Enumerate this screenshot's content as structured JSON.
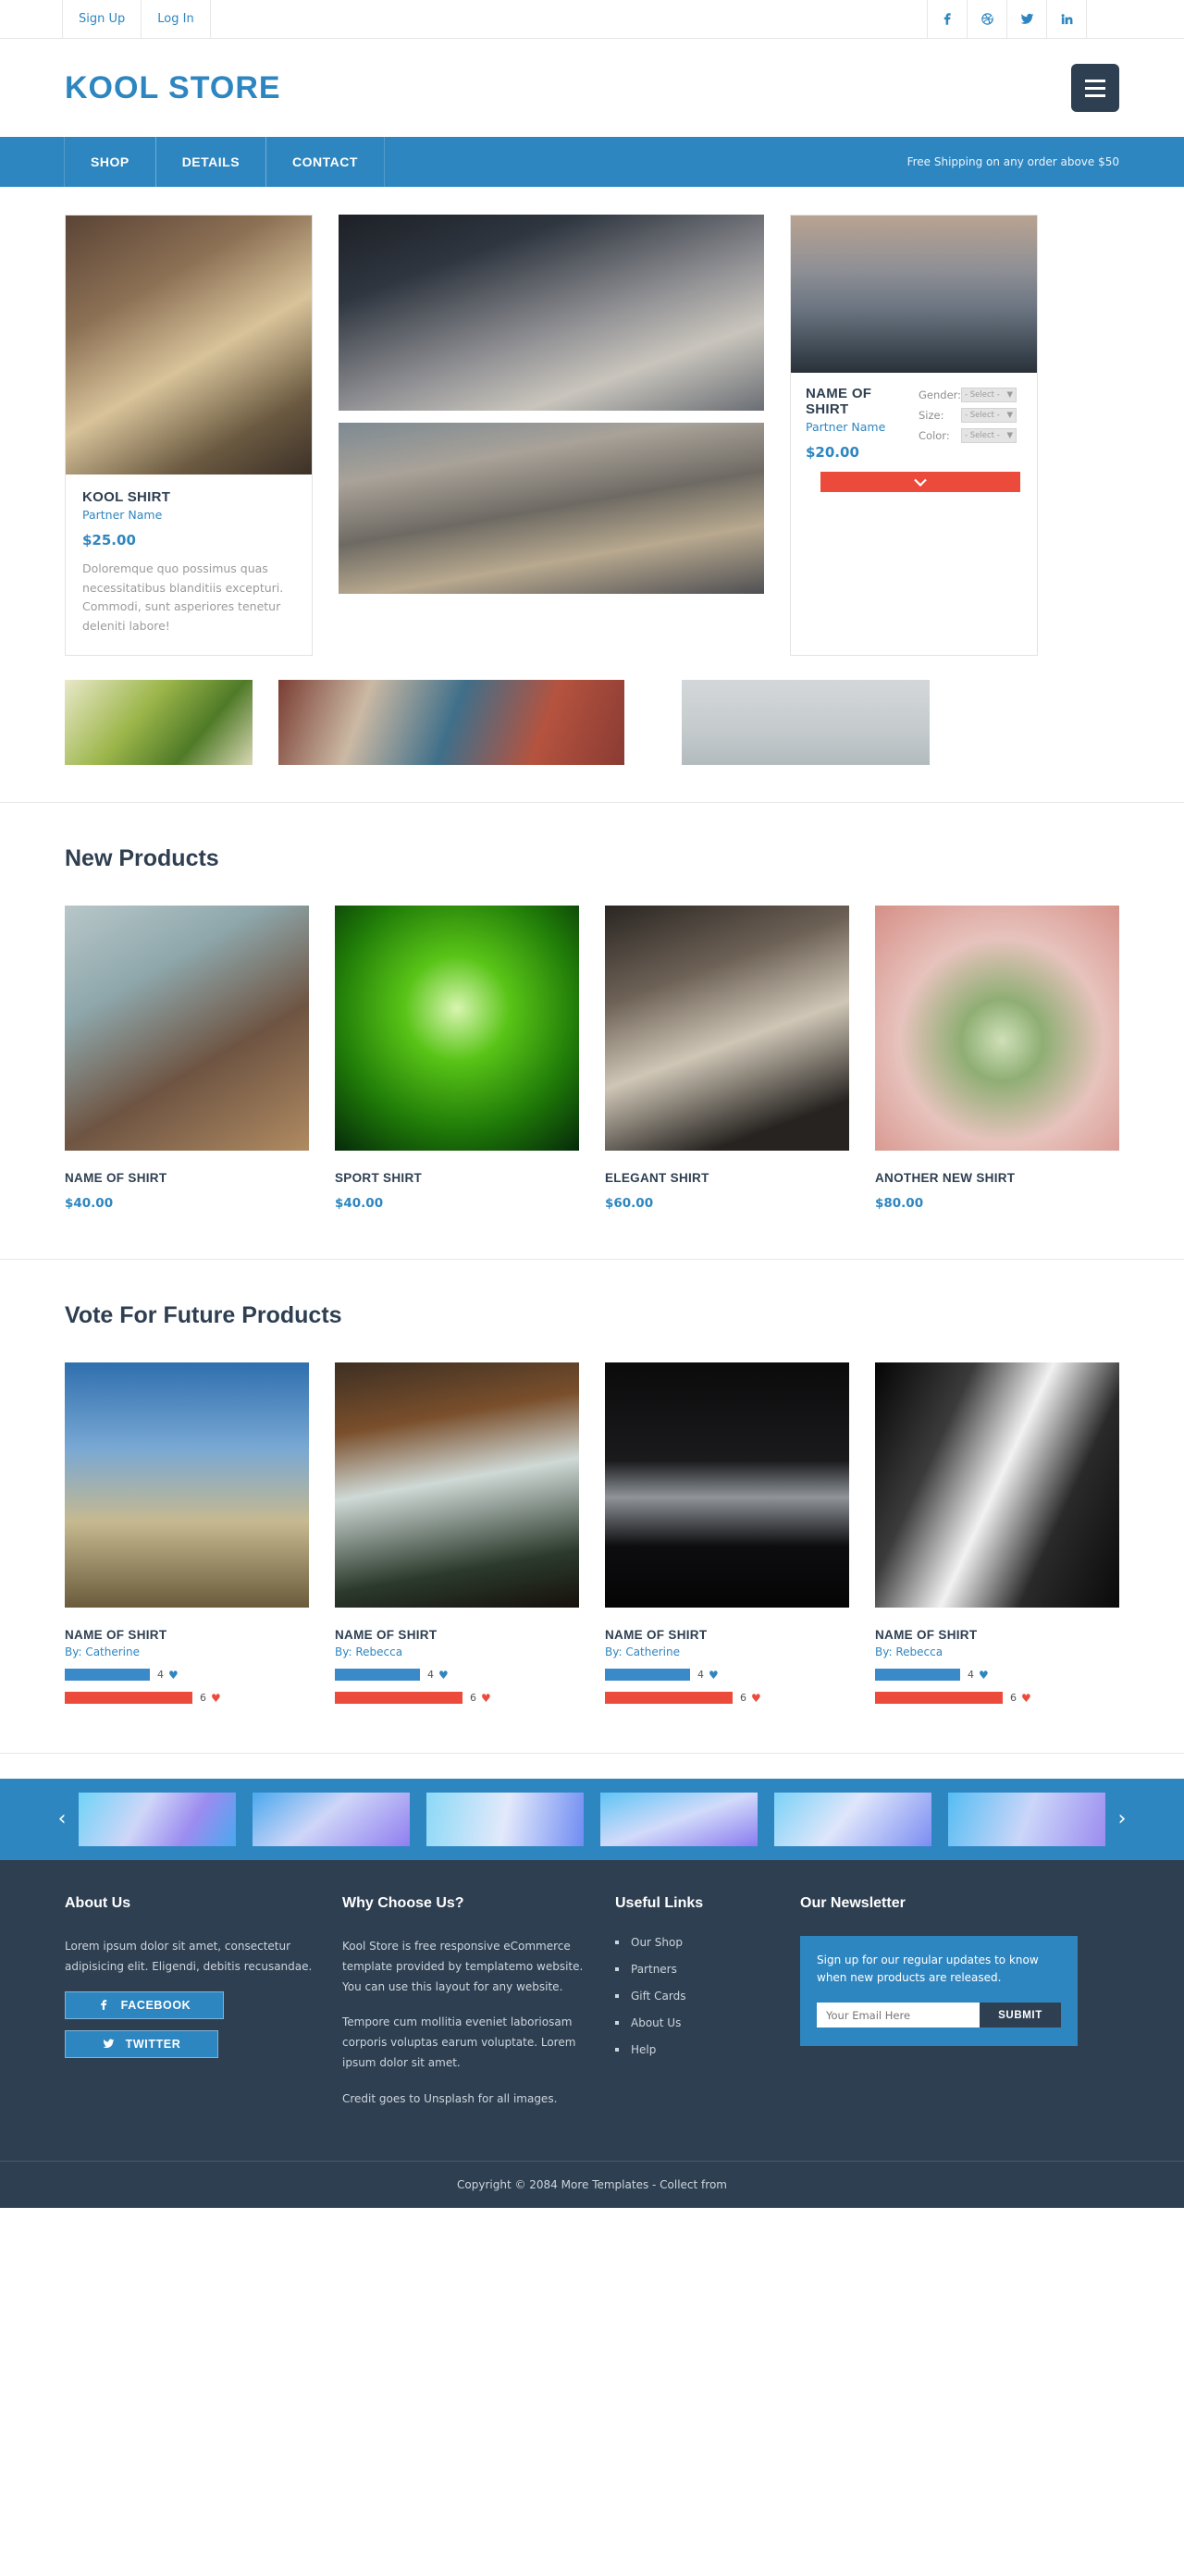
{
  "topbar": {
    "links": [
      {
        "label": "Sign Up",
        "name": "signup-link"
      },
      {
        "label": "Log In",
        "name": "login-link"
      }
    ],
    "social": [
      {
        "name": "facebook-icon",
        "label": "f"
      },
      {
        "name": "dribbble-icon",
        "label": "dribbble"
      },
      {
        "name": "twitter-icon",
        "label": "twitter"
      },
      {
        "name": "linkedin-icon",
        "label": "in"
      }
    ]
  },
  "brand": {
    "title": "KOOL STORE"
  },
  "nav": {
    "items": [
      {
        "label": "SHOP"
      },
      {
        "label": "DETAILS"
      },
      {
        "label": "CONTACT"
      }
    ],
    "note": "Free Shipping on any order above $50"
  },
  "hero": {
    "feature_card": {
      "title": "KOOL SHIRT",
      "partner": "Partner Name",
      "price": "$25.00",
      "description": "Doloremque quo possimus quas necessitatibus blanditiis excepturi. Commodi, sunt asperiores tenetur deleniti labore!"
    },
    "option_card": {
      "title": "NAME OF SHIRT",
      "partner": "Partner Name",
      "price": "$20.00",
      "options": [
        {
          "label": "Gender:",
          "value": "- Select -"
        },
        {
          "label": "Size:",
          "value": "- Select -"
        },
        {
          "label": "Color:",
          "value": "- Select -"
        }
      ],
      "cart_icon": "chevron-down-icon"
    }
  },
  "new_products": {
    "title": "New Products",
    "items": [
      {
        "name": "NAME OF SHIRT",
        "price": "$40.00"
      },
      {
        "name": "SPORT SHIRT",
        "price": "$40.00"
      },
      {
        "name": "ELEGANT SHIRT",
        "price": "$60.00"
      },
      {
        "name": "ANOTHER NEW SHIRT",
        "price": "$80.00"
      }
    ]
  },
  "vote": {
    "title": "Vote For Future Products",
    "items": [
      {
        "name": "NAME OF SHIRT",
        "by": "By: Catherine",
        "up": "4",
        "down": "6"
      },
      {
        "name": "NAME OF SHIRT",
        "by": "By: Rebecca",
        "up": "4",
        "down": "6"
      },
      {
        "name": "NAME OF SHIRT",
        "by": "By: Catherine",
        "up": "4",
        "down": "6"
      },
      {
        "name": "NAME OF SHIRT",
        "by": "By: Rebecca",
        "up": "4",
        "down": "6"
      }
    ]
  },
  "carousel": {
    "prev_icon": "chevron-left-icon",
    "next_icon": "chevron-right-icon",
    "slide_count": 6
  },
  "footer": {
    "about": {
      "heading": "About Us",
      "text": "Lorem ipsum dolor sit amet, consectetur adipisicing elit. Eligendi, debitis recusandae.",
      "facebook_label": "FACEBOOK",
      "twitter_label": "TWITTER"
    },
    "why": {
      "heading": "Why Choose Us?",
      "p1": "Kool Store is free responsive eCommerce template provided by templatemo website. You can use this layout for any website.",
      "p2": "Tempore cum mollitia eveniet laboriosam corporis voluptas earum voluptate. Lorem ipsum dolor sit amet.",
      "p3": "Credit goes to Unsplash for all images."
    },
    "links": {
      "heading": "Useful Links",
      "items": [
        {
          "label": "Our Shop"
        },
        {
          "label": "Partners"
        },
        {
          "label": "Gift Cards"
        },
        {
          "label": "About Us"
        },
        {
          "label": "Help"
        }
      ]
    },
    "newsletter": {
      "heading": "Our Newsletter",
      "text": "Sign up for our regular updates to know when new products are released.",
      "placeholder": "Your Email Here",
      "submit_label": "SUBMIT"
    },
    "copyright": "Copyright © 2084 More Templates - Collect from"
  },
  "colors": {
    "brand_blue": "#2e86c1",
    "dark": "#2e3f51",
    "accent_red": "#ec4a3a"
  }
}
